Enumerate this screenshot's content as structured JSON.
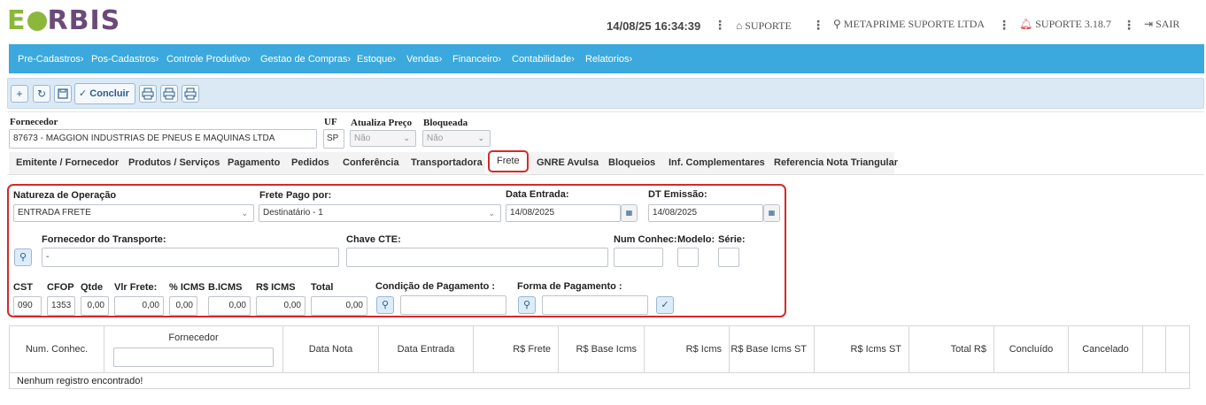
{
  "header": {
    "logo_e": "E",
    "logo_rest": "RBIS",
    "datetime": "14/08/25 16:34:39",
    "support": "SUPORTE",
    "company": "METAPRIME SUPORTE LTDA",
    "version": "SUPORTE 3.18.7",
    "logout": "SAIR"
  },
  "nav": [
    "Pre-Cadastros",
    "Pos-Cadastros",
    "Controle Produtivo",
    "Gestao de Compras",
    "Estoque",
    "Vendas",
    "Financeiro",
    "Contabilidade",
    "Relatorios"
  ],
  "toolbar": {
    "concluir_label": "Concluir"
  },
  "header_form": {
    "fornecedor_label": "Fornecedor",
    "fornecedor_value": "87673 - MAGGION INDUSTRIAS DE PNEUS E MAQUINAS LTDA",
    "uf_label": "UF",
    "uf_value": "SP",
    "atualiza_label": "Atualiza Preço",
    "atualiza_value": "Não",
    "bloqueada_label": "Bloqueada",
    "bloqueada_value": "Não"
  },
  "tabs": [
    "Emitente / Fornecedor",
    "Produtos / Serviços",
    "Pagamento",
    "Pedidos",
    "Conferência",
    "Transportadora",
    "Frete",
    "GNRE Avulsa",
    "Bloqueios",
    "Inf. Complementares",
    "Referencia Nota Triangular"
  ],
  "frete": {
    "natureza_label": "Natureza de Operação",
    "natureza_value": "ENTRADA FRETE",
    "frete_pago_label": "Frete Pago por:",
    "frete_pago_value": "Destinatário - 1",
    "data_entrada_label": "Data Entrada:",
    "data_entrada_value": "14/08/2025",
    "dt_emissao_label": "DT Emissão:",
    "dt_emissao_value": "14/08/2025",
    "fornecedor_transporte_label": "Fornecedor do Transporte:",
    "fornecedor_transporte_value": "-",
    "chave_cte_label": "Chave CTE:",
    "chave_cte_value": "",
    "num_conhec_label": "Num Conhec:",
    "modelo_label": "Modelo:",
    "serie_label": "Série:",
    "cst_label": "CST",
    "cst_value": "090",
    "cfop_label": "CFOP",
    "cfop_value": "1353",
    "qtde_label": "Qtde",
    "qtde_value": "0,00",
    "vlr_frete_label": "Vlr Frete:",
    "vlr_frete_value": "0,00",
    "p_icms_label": "% ICMS",
    "p_icms_value": "0,00",
    "b_icms_label": "B.ICMS",
    "b_icms_value": "0,00",
    "rs_icms_label": "R$ ICMS",
    "rs_icms_value": "0,00",
    "total_label": "Total",
    "total_value": "0,00",
    "cond_pag_label": "Condição de Pagamento :",
    "forma_pag_label": "Forma de Pagamento :"
  },
  "table": {
    "columns": [
      "Num. Conhec.",
      "Fornecedor",
      "Data Nota",
      "Data Entrada",
      "R$ Frete",
      "R$ Base Icms",
      "R$ Icms",
      "R$ Base Icms ST",
      "R$ Icms ST",
      "Total R$",
      "Concluído",
      "Cancelado"
    ],
    "empty": "Nenhum registro encontrado!"
  }
}
